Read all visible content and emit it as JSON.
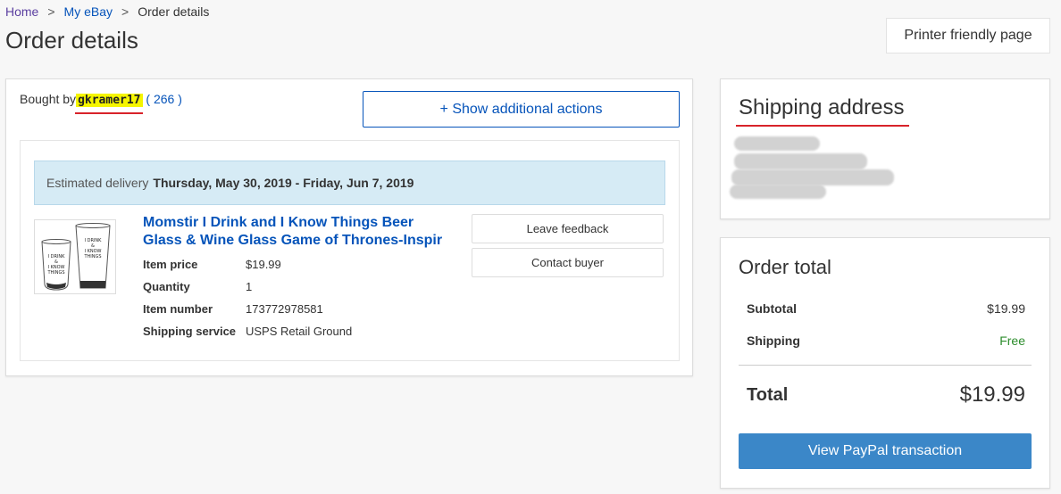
{
  "breadcrumb": {
    "home": "Home",
    "my_ebay": "My eBay",
    "current": "Order details",
    "separator": ">"
  },
  "page": {
    "title": "Order details",
    "printer_label": "Printer friendly page"
  },
  "order": {
    "bought_by_label": "Bought by",
    "username": "gkramer17",
    "feedback_score": "266",
    "actions_label": "+ Show additional actions",
    "delivery_label": "Estimated delivery",
    "delivery_dates": "Thursday, May 30, 2019 - Friday, Jun 7, 2019",
    "item": {
      "title": "Momstir I Drink and I Know Things Beer Glass & Wine Glass Game of Thrones-Inspir",
      "thumbnail_text": "I DRINK & I KNOW THINGS",
      "details": [
        {
          "label": "Item price",
          "value": "$19.99"
        },
        {
          "label": "Quantity",
          "value": "1"
        },
        {
          "label": "Item number",
          "value": "173772978581"
        },
        {
          "label": "Shipping service",
          "value": "USPS Retail Ground"
        }
      ]
    },
    "leave_feedback_label": "Leave feedback",
    "contact_buyer_label": "Contact buyer"
  },
  "shipping": {
    "title": "Shipping address"
  },
  "totals": {
    "title": "Order total",
    "subtotal_label": "Subtotal",
    "subtotal_value": "$19.99",
    "shipping_label": "Shipping",
    "shipping_value": "Free",
    "total_label": "Total",
    "total_value": "$19.99",
    "paypal_label": "View PayPal transaction"
  },
  "colors": {
    "link": "#0654ba",
    "highlight": "#f5f500",
    "annotation_red": "#d8232a",
    "delivery_bg": "#d6ebf5",
    "free_green": "#2c8c2c",
    "paypal_button": "#3b87c8"
  }
}
